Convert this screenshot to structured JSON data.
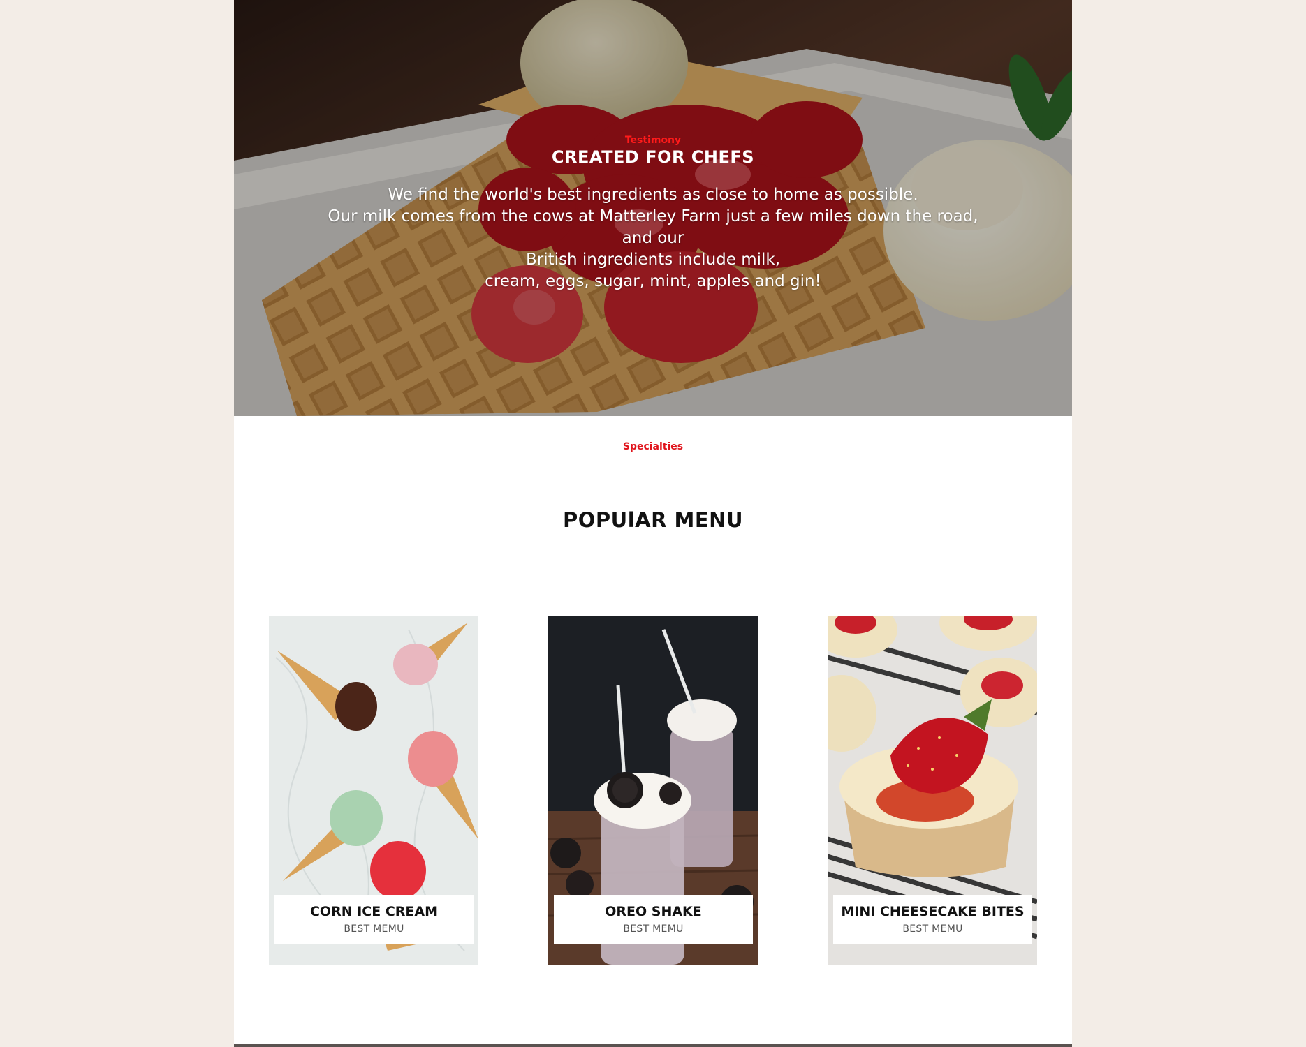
{
  "hero": {
    "eyebrow": "Testimony",
    "title": "CREATED FOR CHEFS",
    "body_lines": [
      "We find the world's best ingredients as close to home as possible.",
      "Our milk comes from the cows at Matterley Farm just a few miles down the road, and our",
      "British ingredients include milk,",
      "cream, eggs, sugar, mint, apples and gin!"
    ]
  },
  "specialties": {
    "eyebrow": "Specialties",
    "title": "POPUlAR MENU"
  },
  "menu": {
    "items": [
      {
        "name": "CORN ICE CREAM",
        "subtitle": "BEST MEMU",
        "image": "ice-cream-cones"
      },
      {
        "name": "OREO SHAKE",
        "subtitle": "BEST MEMU",
        "image": "oreo-milkshake"
      },
      {
        "name": "MINI CHEESECAKE BITES",
        "subtitle": "BEST MEMU",
        "image": "strawberry-cheesecake"
      }
    ]
  },
  "colors": {
    "page_background": "#f3ede7",
    "accent_red": "#e0141c",
    "content_background": "#ffffff"
  }
}
